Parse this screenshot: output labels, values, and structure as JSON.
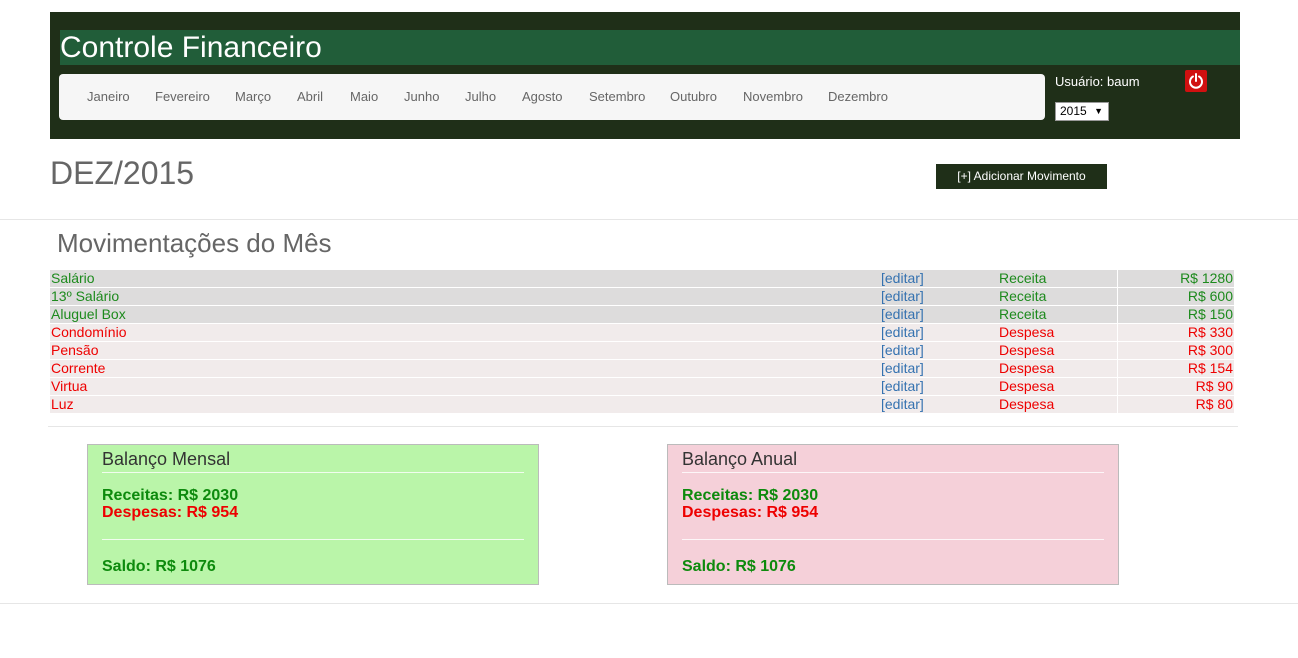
{
  "header": {
    "title": "Controle Financeiro",
    "months": [
      "Janeiro",
      "Fevereiro",
      "Março",
      "Abril",
      "Maio",
      "Junho",
      "Julho",
      "Agosto",
      "Setembro",
      "Outubro",
      "Novembro",
      "Dezembro"
    ],
    "user_label": "Usuário: baum",
    "year": "2015",
    "power_icon": "power-icon"
  },
  "month_title": "DEZ/2015",
  "add_button_label": "[+] Adicionar Movimento",
  "section_title": "Movimentações do Mês",
  "movements": [
    {
      "name": "Salário",
      "edit": "[editar]",
      "type": "Receita",
      "value": "R$ 1280",
      "kind": "receita"
    },
    {
      "name": "13º Salário",
      "edit": "[editar]",
      "type": "Receita",
      "value": "R$ 600",
      "kind": "receita"
    },
    {
      "name": "Aluguel Box",
      "edit": "[editar]",
      "type": "Receita",
      "value": "R$ 150",
      "kind": "receita"
    },
    {
      "name": "Condomínio",
      "edit": "[editar]",
      "type": "Despesa",
      "value": "R$ 330",
      "kind": "despesa"
    },
    {
      "name": "Pensão",
      "edit": "[editar]",
      "type": "Despesa",
      "value": "R$ 300",
      "kind": "despesa"
    },
    {
      "name": "Corrente",
      "edit": "[editar]",
      "type": "Despesa",
      "value": "R$ 154",
      "kind": "despesa"
    },
    {
      "name": "Virtua",
      "edit": "[editar]",
      "type": "Despesa",
      "value": "R$ 90",
      "kind": "despesa"
    },
    {
      "name": "Luz",
      "edit": "[editar]",
      "type": "Despesa",
      "value": "R$ 80",
      "kind": "despesa"
    }
  ],
  "balanco_mensal": {
    "title": "Balanço Mensal",
    "receitas": "Receitas: R$ 2030",
    "despesas": "Despesas: R$ 954",
    "saldo": "Saldo: R$ 1076"
  },
  "balanco_anual": {
    "title": "Balanço Anual",
    "receitas": "Receitas: R$ 2030",
    "despesas": "Despesas: R$ 954",
    "saldo": "Saldo: R$ 1076"
  },
  "colors": {
    "header_bg": "#1f2f18",
    "title_band": "#215d39",
    "receita": "#1d8a1d",
    "despesa": "#ee0000",
    "link": "#3572b0",
    "mensal_bg": "#baf5a9",
    "anual_bg": "#f5d0d9"
  }
}
